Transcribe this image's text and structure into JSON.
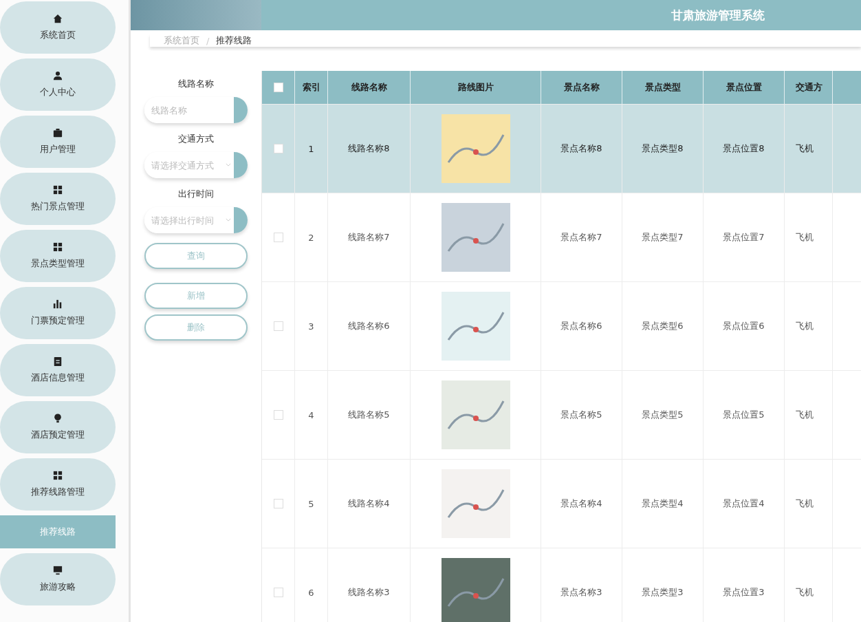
{
  "header": {
    "title": "甘肃旅游管理系统"
  },
  "sidebar": {
    "items": [
      {
        "label": "系统首页",
        "selected": false
      },
      {
        "label": "个人中心",
        "selected": false
      },
      {
        "label": "用户管理",
        "selected": false
      },
      {
        "label": "热门景点管理",
        "selected": false
      },
      {
        "label": "景点类型管理",
        "selected": false
      },
      {
        "label": "门票预定管理",
        "selected": false
      },
      {
        "label": "酒店信息管理",
        "selected": false
      },
      {
        "label": "酒店预定管理",
        "selected": false
      },
      {
        "label": "推荐线路管理",
        "selected": false,
        "children": [
          {
            "label": "推荐线路",
            "selected": true
          }
        ]
      },
      {
        "label": "旅游攻略",
        "selected": false
      }
    ]
  },
  "breadcrumb": {
    "separator": "/",
    "items": [
      "系统首页",
      "推荐线路"
    ]
  },
  "filters": [
    {
      "label": "线路名称",
      "kind": "input",
      "placeholder": "线路名称"
    },
    {
      "label": "交通方式",
      "kind": "select",
      "placeholder": "请选择交通方式"
    },
    {
      "label": "出行时间",
      "kind": "select",
      "placeholder": "请选择出行时间"
    }
  ],
  "buttons": {
    "search": "查询",
    "actions": [
      "新增",
      "删除"
    ]
  },
  "table": {
    "select_all_checked": false,
    "columns": [
      "索引",
      "线路名称",
      "路线图片",
      "景点名称",
      "景点类型",
      "景点位置",
      "交通方"
    ],
    "rows": [
      {
        "selected": true,
        "checked": false,
        "cells": [
          "1",
          "线路名称8",
          "",
          "景点名称8",
          "景点类型8",
          "景点位置8",
          "飞机"
        ]
      },
      {
        "selected": false,
        "checked": false,
        "cells": [
          "2",
          "线路名称7",
          "",
          "景点名称7",
          "景点类型7",
          "景点位置7",
          "飞机"
        ]
      },
      {
        "selected": false,
        "checked": false,
        "cells": [
          "3",
          "线路名称6",
          "",
          "景点名称6",
          "景点类型6",
          "景点位置6",
          "飞机"
        ]
      },
      {
        "selected": false,
        "checked": false,
        "cells": [
          "4",
          "线路名称5",
          "",
          "景点名称5",
          "景点类型5",
          "景点位置5",
          "飞机"
        ]
      },
      {
        "selected": false,
        "checked": false,
        "cells": [
          "5",
          "线路名称4",
          "",
          "景点名称4",
          "景点类型4",
          "景点位置4",
          "飞机"
        ]
      },
      {
        "selected": false,
        "checked": false,
        "cells": [
          "6",
          "线路名称3",
          "",
          "景点名称3",
          "景点类型3",
          "景点位置3",
          "飞机"
        ]
      }
    ]
  }
}
